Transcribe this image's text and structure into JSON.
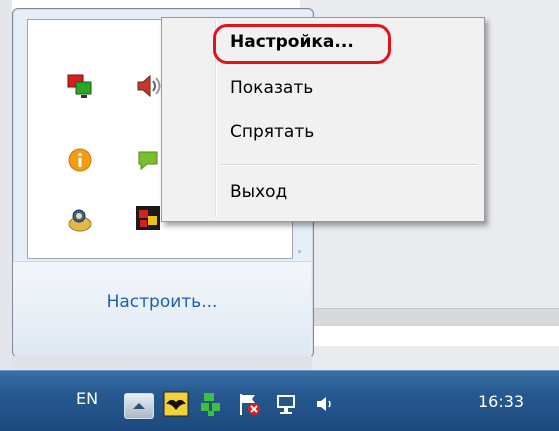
{
  "context_menu": {
    "items": [
      {
        "label": "Настройка...",
        "bold": true,
        "highlighted": true
      },
      {
        "label": "Показать"
      },
      {
        "label": "Спрятать"
      },
      {
        "label": "Выход"
      }
    ],
    "highlight_color": "#e0151b"
  },
  "tray_flyout": {
    "customize_label": "Настроить...",
    "icons": [
      "network-icon",
      "speaker-icon",
      "info-icon",
      "chat-icon",
      "user-icon",
      "app-icon"
    ]
  },
  "taskbar": {
    "language": "EN",
    "clock": "16:33",
    "icons": [
      "show-hidden-icons-button",
      "bat-icon",
      "green-app-icon",
      "flag-icon",
      "network-icon",
      "volume-icon"
    ]
  }
}
